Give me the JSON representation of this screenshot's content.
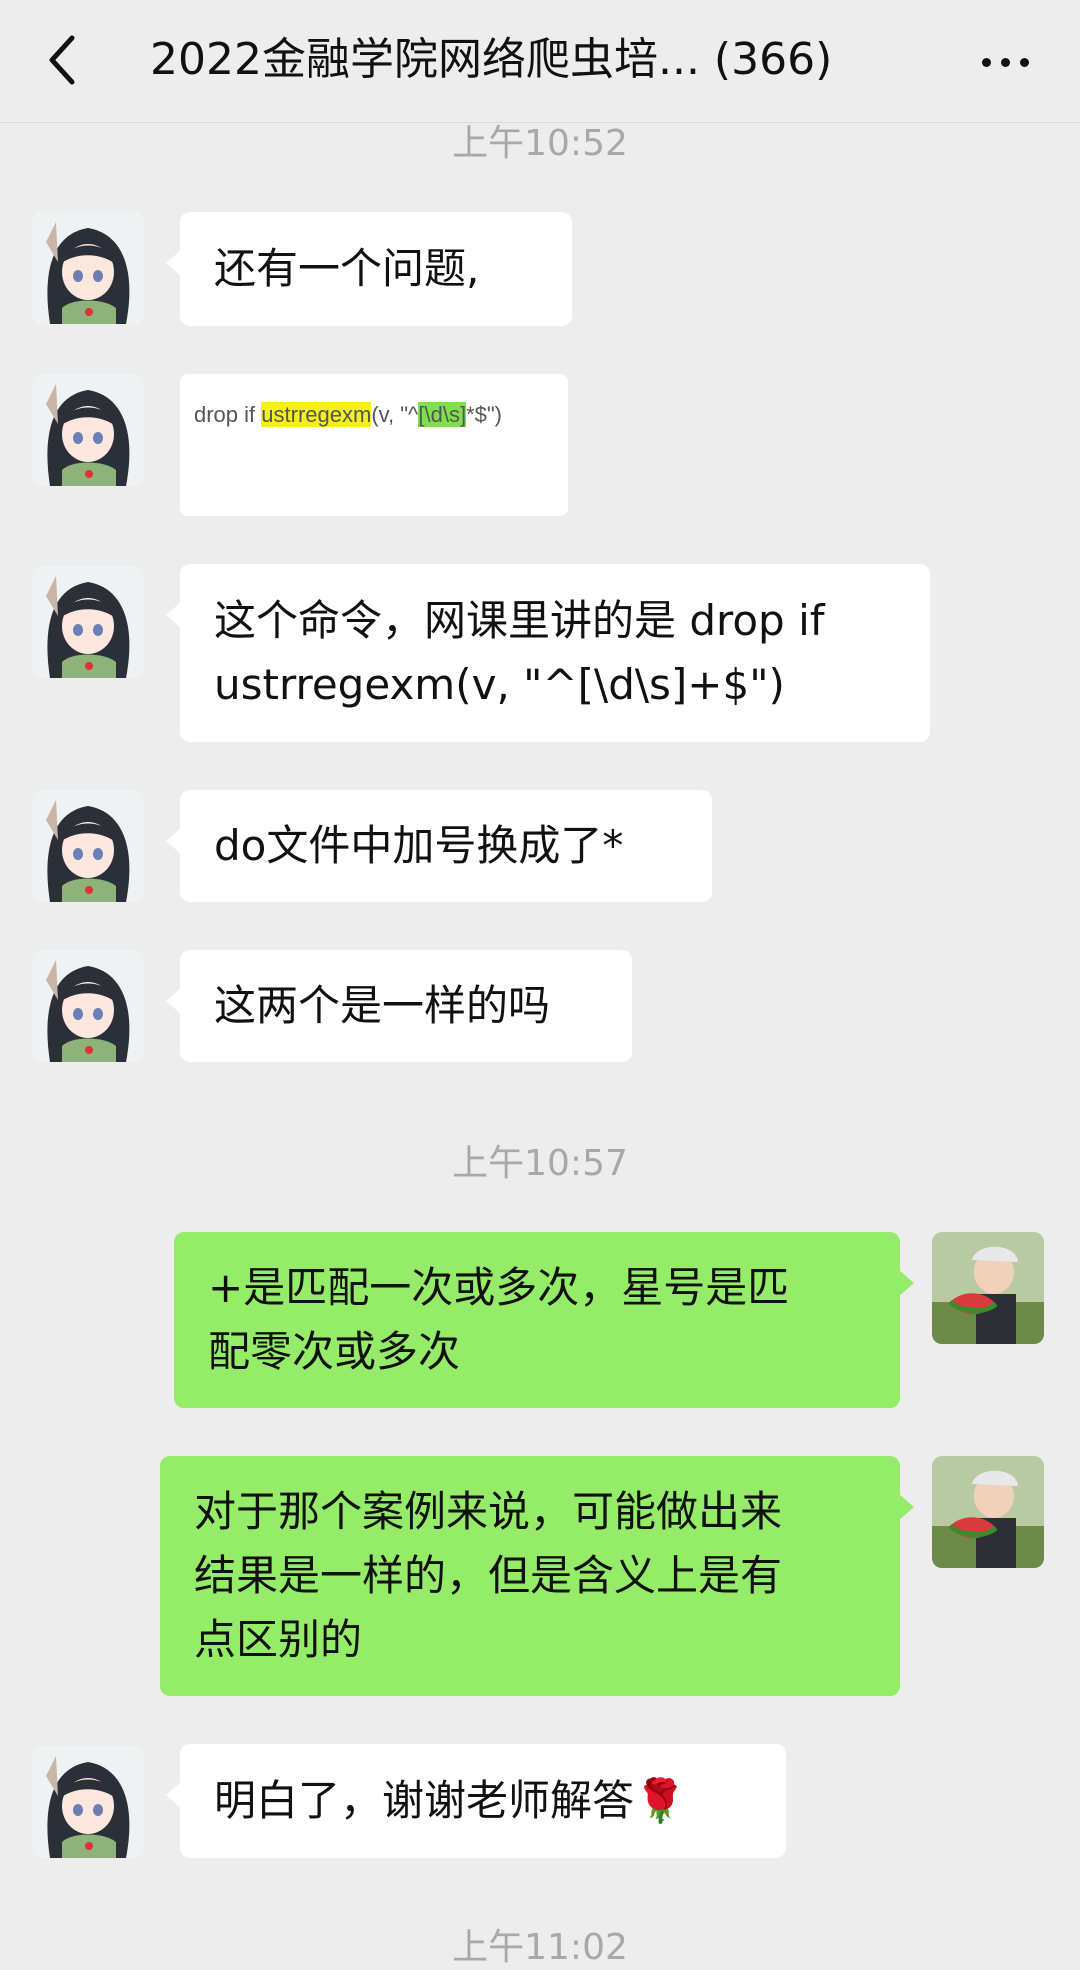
{
  "header": {
    "title": "2022金融学院网络爬虫培... (366)"
  },
  "timestamps": [
    "上午10:52",
    "上午10:57",
    "上午11:02"
  ],
  "messages": [
    {
      "side": "left",
      "text": "还有一个问题,"
    },
    {
      "side": "left",
      "type": "image",
      "code": {
        "pre": "drop if ",
        "fn": "ustrregexm",
        "mid": "(v, \"^",
        "cls": "[\\d\\s]",
        "post": "*$\")"
      }
    },
    {
      "side": "left",
      "text_line1": "这个命令，网课里讲的是 drop if",
      "text_line2": "ustrregexm(v, \"^[\\d\\s]+$\")"
    },
    {
      "side": "left",
      "text": "do文件中加号换成了*"
    },
    {
      "side": "left",
      "text": "这两个是一样的吗"
    },
    {
      "side": "right",
      "text_line1": "+是匹配一次或多次，星号是匹",
      "text_line2": "配零次或多次"
    },
    {
      "side": "right",
      "text_line1": "对于那个案例来说，可能做出来",
      "text_line2": "结果是一样的，但是含义上是有",
      "text_line3": "点区别的"
    },
    {
      "side": "left",
      "text": "明白了，谢谢老师解答🌹"
    }
  ],
  "colors": {
    "background": "#ededed",
    "bubble_left": "#ffffff",
    "bubble_right": "#95ec69",
    "timestamp": "#a8a8a8"
  },
  "icons": [
    "back-chevron-icon",
    "more-dots-icon",
    "avatar-anime-girl",
    "avatar-boy-watermelon"
  ]
}
